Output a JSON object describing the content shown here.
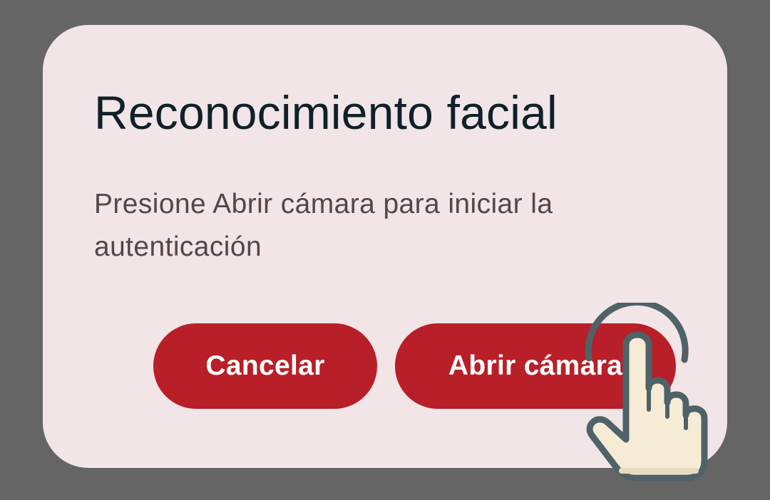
{
  "dialog": {
    "title": "Reconocimiento facial",
    "message": "Presione Abrir cámara para iniciar la autenticación",
    "cancel_label": "Cancelar",
    "open_camera_label": "Abrir cámara"
  },
  "colors": {
    "scrim": "#656565",
    "dialog_background": "#f1e5e7",
    "button": "#b81f28",
    "button_text": "#ffffff",
    "title_text": "#102028",
    "body_text": "#574448"
  },
  "icons": {
    "pointer": "tap-hand-icon"
  }
}
